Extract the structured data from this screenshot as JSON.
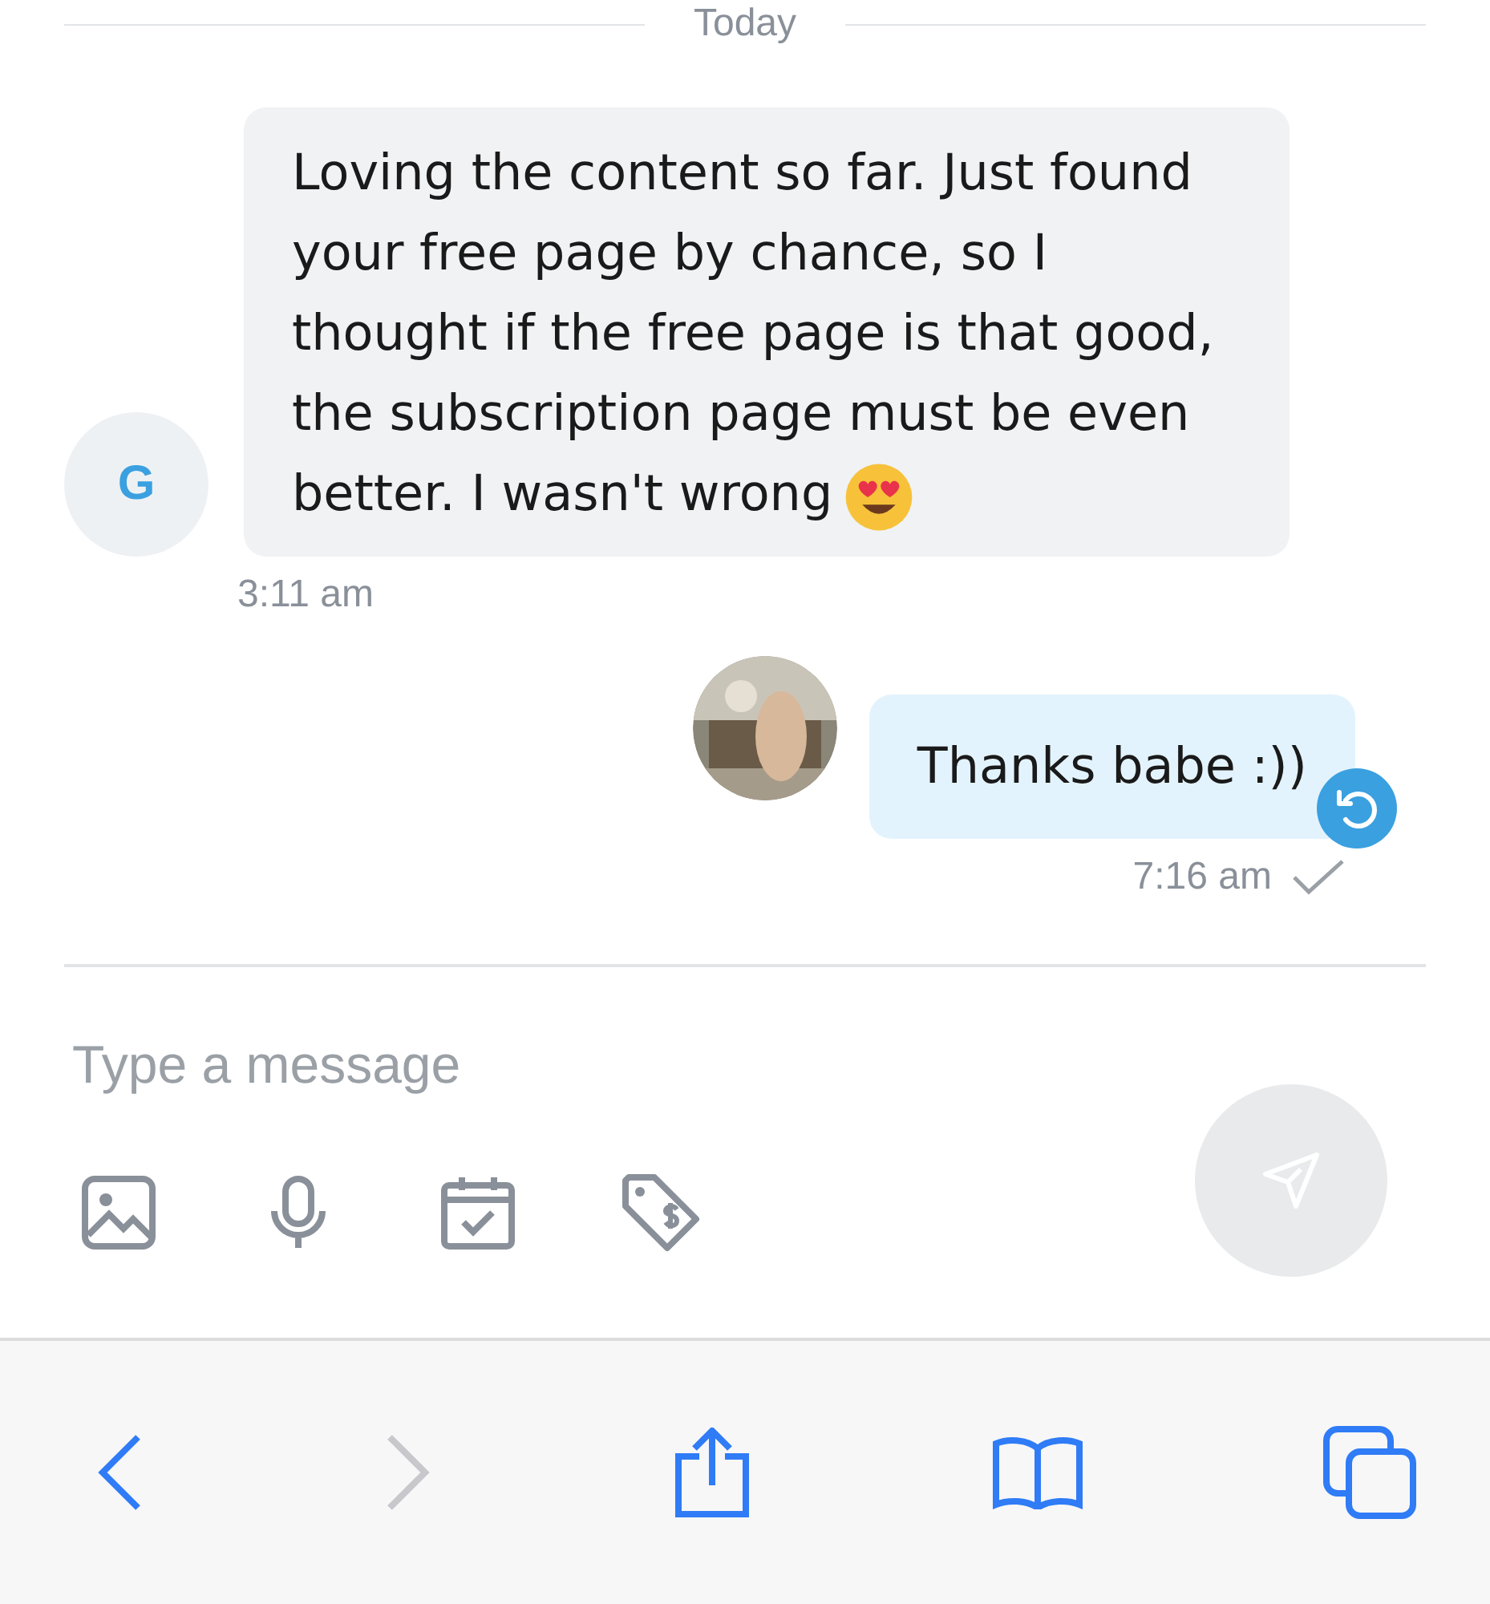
{
  "date_divider": "Today",
  "messages": [
    {
      "kind": "incoming",
      "avatar_letter": "G",
      "text": "Loving the content so far. Just found your free page by chance, so I thought if the free page is that good, the subscription page must be even better. I wasn't wrong",
      "emoji": true,
      "time": "3:11 am"
    },
    {
      "kind": "outgoing",
      "text": "Thanks babe :))",
      "time": "7:16 am",
      "delivered": true
    }
  ],
  "composer": {
    "placeholder": "Type a message",
    "send_enabled": false
  },
  "browser_toolbar": {
    "back_disabled": false,
    "forward_disabled": true
  }
}
